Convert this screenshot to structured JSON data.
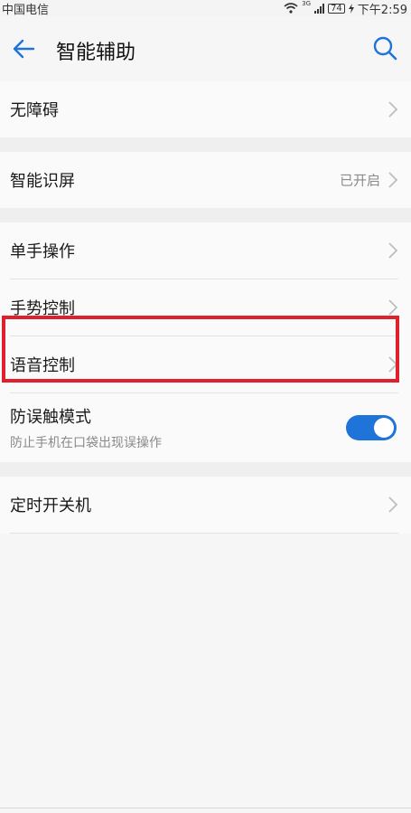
{
  "status_bar": {
    "carrier": "中国电信",
    "battery": "74",
    "time": "下午2:59",
    "network": "3G"
  },
  "header": {
    "title": "智能辅助"
  },
  "items": {
    "accessibility": {
      "label": "无障碍"
    },
    "smart_screen": {
      "label": "智能识屏",
      "value": "已开启"
    },
    "one_hand": {
      "label": "单手操作"
    },
    "gesture": {
      "label": "手势控制"
    },
    "voice": {
      "label": "语音控制"
    },
    "mistouch": {
      "label": "防误触模式",
      "sublabel": "防止手机在口袋出现误操作",
      "enabled": true
    },
    "schedule_power": {
      "label": "定时开关机"
    }
  },
  "colors": {
    "accent": "#1e74d8",
    "highlight": "#e0202c"
  }
}
